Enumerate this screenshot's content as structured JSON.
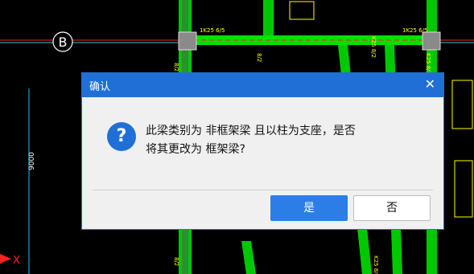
{
  "cad": {
    "axis_label": "B",
    "dim_label": "9000",
    "beam_labels": [
      "1K25 6/5",
      "1K25 6/5",
      "8/2",
      "8/2",
      "K25 8/2",
      "K25 8/2",
      "8/2",
      "K25 8/2"
    ],
    "coord_x_label": "X"
  },
  "dialog": {
    "title": "确认",
    "close_symbol": "✕",
    "icon_symbol": "?",
    "message_line1": "此梁类别为 非框架梁 且以柱为支座，是否",
    "message_line2": "将其更改为 框架梁?",
    "yes_label": "是",
    "no_label": "否"
  },
  "colors": {
    "accent": "#1f6fd6",
    "button_primary": "#2d7de6",
    "cad_beam_green": "#00e000",
    "cad_background": "#000000"
  }
}
